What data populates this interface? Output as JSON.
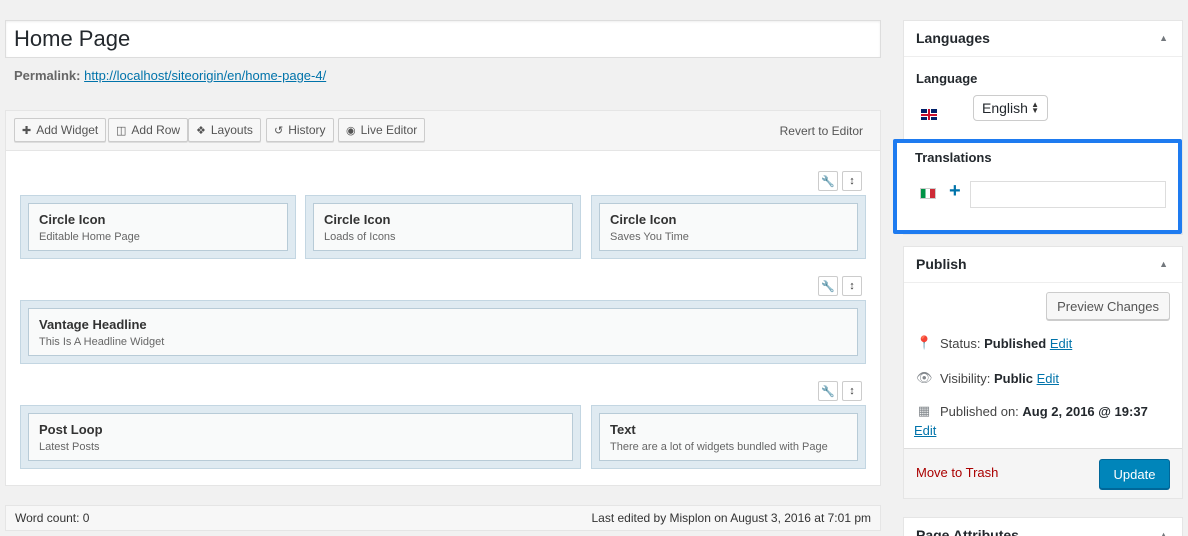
{
  "post": {
    "title": "Home Page",
    "permalink_label": "Permalink:",
    "permalink_url": "http://localhost/siteorigin/en/home-page-4/"
  },
  "toolbar": {
    "add_widget": "Add Widget",
    "add_row": "Add Row",
    "layouts": "Layouts",
    "history": "History",
    "live_editor": "Live Editor",
    "revert": "Revert to Editor"
  },
  "rows": [
    {
      "widgets": [
        {
          "title": "Circle Icon",
          "desc": "Editable Home Page"
        },
        {
          "title": "Circle Icon",
          "desc": "Loads of Icons"
        },
        {
          "title": "Circle Icon",
          "desc": "Saves You Time"
        }
      ]
    },
    {
      "widgets": [
        {
          "title": "Vantage Headline",
          "desc": "This Is A Headline Widget"
        }
      ]
    },
    {
      "widgets": [
        {
          "title": "Post Loop",
          "desc": "Latest Posts"
        },
        {
          "title": "Text",
          "desc": "There are a lot of widgets bundled with Page"
        }
      ]
    }
  ],
  "status_bar": {
    "word_count": "Word count: 0",
    "last_edited": "Last edited by Misplon on August 3, 2016 at 7:01 pm"
  },
  "languages_box": {
    "title": "Languages",
    "language_label": "Language",
    "selected_language": "English",
    "translations_label": "Translations"
  },
  "publish_box": {
    "title": "Publish",
    "preview": "Preview Changes",
    "status_label": "Status:",
    "status_value": "Published",
    "visibility_label": "Visibility:",
    "visibility_value": "Public",
    "published_label": "Published on:",
    "published_value": "Aug 2, 2016 @ 19:37",
    "edit": "Edit",
    "trash": "Move to Trash",
    "update": "Update"
  },
  "page_attributes": {
    "title": "Page Attributes"
  }
}
